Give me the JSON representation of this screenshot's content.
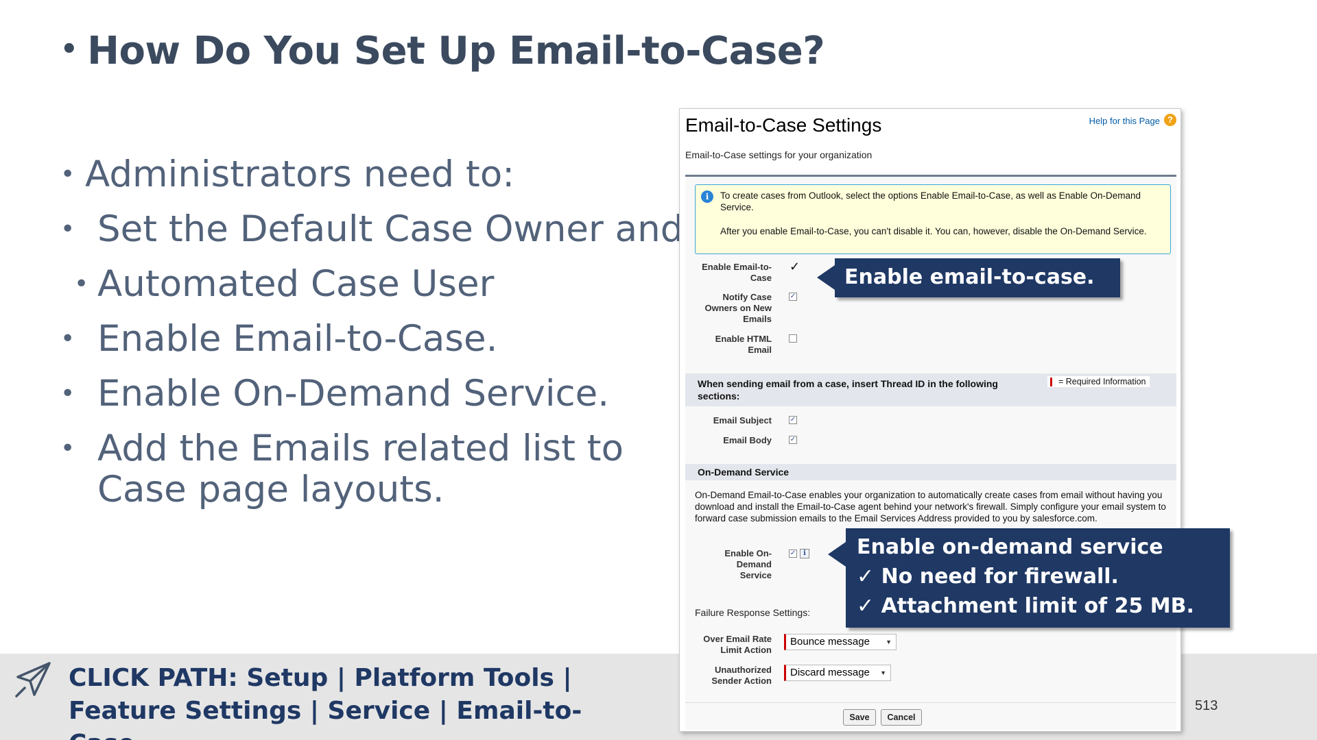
{
  "slide": {
    "title": "How Do You Set Up Email-to-Case?",
    "bullets": [
      "Administrators need to:",
      "Set the Default Case Owner and",
      "Automated Case User",
      "Enable Email-to-Case.",
      "Enable On-Demand Service.",
      "Add the Emails related list to Case page layouts."
    ],
    "bullet_glyph": "•",
    "click_path": "CLICK PATH: Setup | Platform Tools | Feature Settings | Service | Email-to-Case",
    "page_number": "513",
    "accent_color": "#1f3864",
    "icons": [
      "paper-plane-icon"
    ]
  },
  "sf": {
    "title": "Email-to-Case Settings",
    "help_link": "Help for this Page",
    "subtitle": "Email-to-Case settings for your organization",
    "info_p1": "To create cases from Outlook, select the options Enable Email-to-Case, as well as Enable On-Demand Service.",
    "info_p2": "After you enable Email-to-Case, you can't disable it. You can, however, disable the On-Demand Service.",
    "fields": {
      "enable_e2c": "Enable Email-to-Case",
      "notify": "Notify Case Owners on New Emails",
      "enable_html": "Enable HTML Email",
      "email_subject": "Email Subject",
      "email_body": "Email Body",
      "enable_ondemand": "Enable On-Demand Service",
      "over_rate": "Over Email Rate Limit Action",
      "unauth": "Unauthorized Sender Action"
    },
    "checkboxes": {
      "enable_e2c": true,
      "notify": true,
      "enable_html": false,
      "email_subject": true,
      "email_body": true,
      "enable_ondemand": true
    },
    "thread_header": "When sending email from a case, insert Thread ID in the following sections:",
    "required_info": "= Required Information",
    "ondemand_header": "On-Demand Service",
    "ondemand_desc": "On-Demand Email-to-Case enables your organization to automatically create cases from email without having you download and install the Email-to-Case agent behind your network's firewall. Simply configure your email system to forward case submission emails to the Email Services Address provided to you by salesforce.com.",
    "failure_label": "Failure Response Settings:",
    "over_rate_value": "Bounce message",
    "unauth_value": "Discard message",
    "save": "Save",
    "cancel": "Cancel"
  },
  "callouts": {
    "enable_e2c": "Enable email-to-case.",
    "ondemand_title": "Enable on-demand service",
    "ondemand_point1": "✓ No need for firewall.",
    "ondemand_point2": "✓ Attachment limit of 25 MB."
  }
}
